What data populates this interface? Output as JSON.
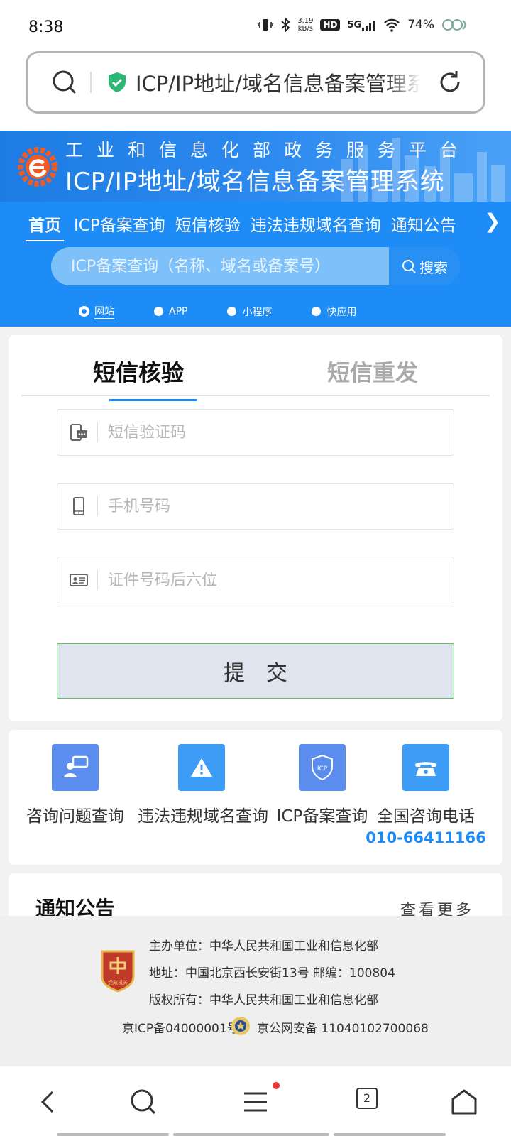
{
  "status_bar": {
    "time": "8:38",
    "net_speed_value": "3.19",
    "net_speed_unit": "kB/s",
    "hd_label": "HD",
    "signal_label": "5G",
    "battery": "74%"
  },
  "address_bar": {
    "url_text": "ICP/IP地址/域名信息备案管理系统"
  },
  "site_header": {
    "subtitle": "工业和信息化部政务服务平台",
    "title": "ICP/IP地址/域名信息备案管理系统"
  },
  "nav": {
    "tabs": [
      {
        "label": "首页"
      },
      {
        "label": "ICP备案查询"
      },
      {
        "label": "短信核验"
      },
      {
        "label": "违法违规域名查询"
      },
      {
        "label": "通知公告"
      }
    ],
    "more_icon": "chevron-right-icon"
  },
  "search": {
    "placeholder": "ICP备案查询（名称、域名或备案号）",
    "button_label": "搜索",
    "types": [
      {
        "label": "网站",
        "selected": true
      },
      {
        "label": "APP",
        "selected": false
      },
      {
        "label": "小程序",
        "selected": false
      },
      {
        "label": "快应用",
        "selected": false
      }
    ]
  },
  "sms_form": {
    "tabs": [
      {
        "label": "短信核验",
        "active": true
      },
      {
        "label": "短信重发",
        "active": false
      }
    ],
    "fields": {
      "sms_code_placeholder": "短信验证码",
      "phone_placeholder": "手机号码",
      "id_last6_placeholder": "证件号码后六位"
    },
    "submit_label": "提交"
  },
  "quick_links": [
    {
      "label": "咨询问题查询",
      "icon": "consult-icon",
      "color": "#5b8def"
    },
    {
      "label": "违法违规域名查询",
      "icon": "warning-icon",
      "color": "#3d9cf5"
    },
    {
      "label": "ICP备案查询",
      "icon": "icp-shield-icon",
      "color": "#5b8def"
    },
    {
      "label": "全国咨询电话",
      "icon": "phone-icon",
      "color": "#3d9cf5",
      "value": "010-66411166"
    }
  ],
  "notice": {
    "title": "通知公告",
    "more_label": "查看更多"
  },
  "footer": {
    "host": "主办单位：中华人民共和国工业和信息化部",
    "address": "地址：中国北京西长安街13号 邮编：100804",
    "copyright": "版权所有：中华人民共和国工业和信息化部",
    "icp": "京ICP备04000001号",
    "police_record": "京公网安备 11040102700068",
    "badge_text": "党政机关"
  },
  "bottom_nav": {
    "tab_count": "2"
  },
  "colors": {
    "primary": "#1e8cf6",
    "header_blue": "#1d7ce3",
    "submit_bg": "#dfe4ef",
    "submit_border": "#60c060"
  }
}
